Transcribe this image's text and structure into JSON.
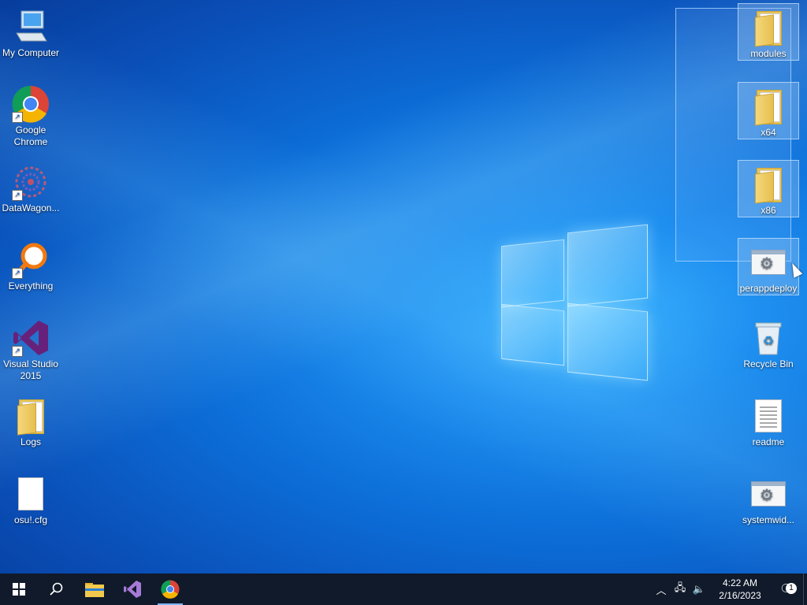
{
  "desktop": {
    "left_icons": [
      {
        "label": "My Computer",
        "icon": "computer-icon",
        "shortcut": false
      },
      {
        "label": "Google Chrome",
        "icon": "chrome-icon",
        "shortcut": true
      },
      {
        "label": "DataWagon...",
        "icon": "datawagon-icon",
        "shortcut": true
      },
      {
        "label": "Everything",
        "icon": "everything-icon",
        "shortcut": true
      },
      {
        "label": "Visual Studio 2015",
        "icon": "visual-studio-icon",
        "shortcut": true
      },
      {
        "label": "Logs",
        "icon": "folder-icon",
        "shortcut": false
      },
      {
        "label": "osu!.cfg",
        "icon": "file-icon",
        "shortcut": false
      }
    ],
    "right_icons": [
      {
        "label": "modules",
        "icon": "folder-icon",
        "selected": true
      },
      {
        "label": "x64",
        "icon": "folder-icon",
        "selected": true
      },
      {
        "label": "x86",
        "icon": "folder-icon",
        "selected": true
      },
      {
        "label": "perappdeploy",
        "icon": "setup-config-icon",
        "selected": true
      },
      {
        "label": "Recycle Bin",
        "icon": "recycle-bin-icon",
        "selected": false
      },
      {
        "label": "readme",
        "icon": "text-document-icon",
        "selected": false
      },
      {
        "label": "systemwid...",
        "icon": "setup-config-icon",
        "selected": false
      }
    ]
  },
  "taskbar": {
    "buttons": [
      {
        "name": "start-button",
        "icon": "windows-icon"
      },
      {
        "name": "search-button",
        "icon": "search-icon"
      },
      {
        "name": "file-explorer-button",
        "icon": "folder-icon"
      },
      {
        "name": "visual-studio-button",
        "icon": "visual-studio-icon"
      },
      {
        "name": "chrome-button",
        "icon": "chrome-icon",
        "active": true
      }
    ],
    "tray": {
      "time": "4:22 AM",
      "date": "2/16/2023",
      "notification_count": "1"
    }
  }
}
